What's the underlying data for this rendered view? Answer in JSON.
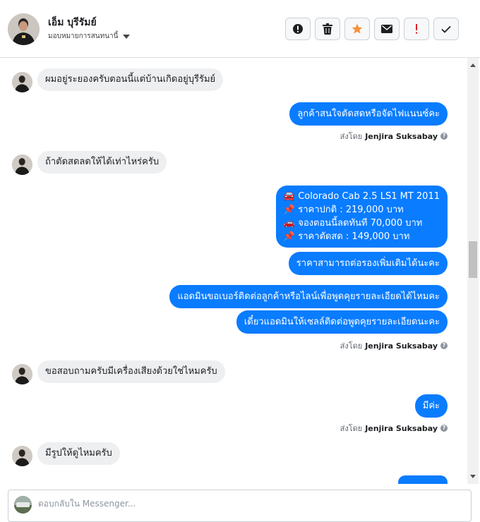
{
  "header": {
    "contact_name": "เอ็ม บุรีรัมย์",
    "assign_label": "มอบหมายการสนทนานี้",
    "actions": [
      {
        "name": "mark-spam",
        "icon": "alert-circle-icon"
      },
      {
        "name": "delete",
        "icon": "trash-icon"
      },
      {
        "name": "star",
        "icon": "star-icon",
        "color": "#f7923b"
      },
      {
        "name": "mark-unread",
        "icon": "envelope-icon"
      },
      {
        "name": "follow-up",
        "icon": "exclamation-icon",
        "color": "#e02020"
      },
      {
        "name": "mark-done",
        "icon": "check-icon"
      }
    ]
  },
  "messages": {
    "m1": "ผมอยู่ระยองครับตอนนี้แต่บ้านเกิดอยู่บุรีรัมย์",
    "m2": "ลูกค้าสนใจตัดสดหรือจัดไฟแนนซ์คะ",
    "m3": "ถ้าตัดสดลดให้ได้เท่าไหร่ครับ",
    "m4": {
      "lines": [
        {
          "emoji": "🚘",
          "text": "Colorado Cab 2.5 LS1 MT 2011"
        },
        {
          "emoji": "📌",
          "text": "ราคาปกติ : 219,000 บาท"
        },
        {
          "emoji": "🚗",
          "text": "จองตอนนี้ลดทันที 70,000 บาท"
        },
        {
          "emoji": "📌",
          "text": "ราคาตัดสด : 149,000 บาท"
        }
      ]
    },
    "m5": "ราคาสามารถต่อรองเพิ่มเติมได้นะคะ",
    "m6": "แอดมินขอเบอร์ติดต่อลูกค้าหรือไลน์เพื่อพูดคุยรายละเอียดได้ไหมคะ",
    "m7": "เดี๋ยวแอดมินให้เซลล์ติดต่อพูดคุยรายละเอียดนะคะ",
    "m8": "ขอสอบถามครับมีเครื่องเสียงด้วยใช่ไหมครับ",
    "m9": "มีค่ะ",
    "m10": "มีรูปให้ดูไหมครับ"
  },
  "sent_by": {
    "prefix": "ส่งโดย",
    "name": "Jenjira Suksabay",
    "help_glyph": "?"
  },
  "composer": {
    "placeholder": "ตอบกลับใน Messenger..."
  },
  "colors": {
    "outgoing": "#0a7cff",
    "incoming": "#eeeff1"
  }
}
